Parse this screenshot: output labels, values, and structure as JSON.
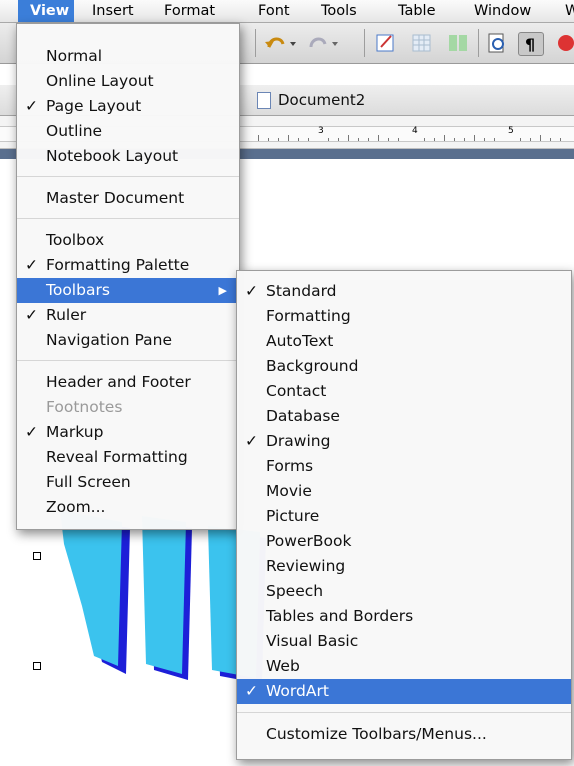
{
  "menubar": {
    "items": [
      "View",
      "Insert",
      "Format",
      "Font",
      "Tools",
      "Table",
      "Window",
      "W"
    ],
    "active": "View"
  },
  "document": {
    "title": "Document2"
  },
  "ruler": {
    "numbers": [
      "3",
      "4",
      "5"
    ]
  },
  "view_menu": {
    "items": [
      {
        "label": "Normal",
        "checked": false
      },
      {
        "label": "Online Layout",
        "checked": false
      },
      {
        "label": "Page Layout",
        "checked": true
      },
      {
        "label": "Outline",
        "checked": false
      },
      {
        "label": "Notebook Layout",
        "checked": false
      },
      {
        "label": "Master Document",
        "checked": false
      },
      {
        "label": "Toolbox",
        "checked": false
      },
      {
        "label": "Formatting Palette",
        "checked": true
      },
      {
        "label": "Toolbars",
        "checked": false,
        "submenu": true,
        "highlighted": true
      },
      {
        "label": "Ruler",
        "checked": true
      },
      {
        "label": "Navigation Pane",
        "checked": false
      },
      {
        "label": "Header and Footer",
        "checked": false
      },
      {
        "label": "Footnotes",
        "checked": false,
        "disabled": true
      },
      {
        "label": "Markup",
        "checked": true
      },
      {
        "label": "Reveal Formatting",
        "checked": false
      },
      {
        "label": "Full Screen",
        "checked": false
      },
      {
        "label": "Zoom...",
        "checked": false
      }
    ]
  },
  "toolbars_submenu": {
    "items": [
      {
        "label": "Standard",
        "checked": true
      },
      {
        "label": "Formatting",
        "checked": false
      },
      {
        "label": "AutoText",
        "checked": false
      },
      {
        "label": "Background",
        "checked": false
      },
      {
        "label": "Contact",
        "checked": false
      },
      {
        "label": "Database",
        "checked": false
      },
      {
        "label": "Drawing",
        "checked": true
      },
      {
        "label": "Forms",
        "checked": false
      },
      {
        "label": "Movie",
        "checked": false
      },
      {
        "label": "Picture",
        "checked": false
      },
      {
        "label": "PowerBook",
        "checked": false
      },
      {
        "label": "Reviewing",
        "checked": false
      },
      {
        "label": "Speech",
        "checked": false
      },
      {
        "label": "Tables and Borders",
        "checked": false
      },
      {
        "label": "Visual Basic",
        "checked": false
      },
      {
        "label": "Web",
        "checked": false
      },
      {
        "label": "WordArt",
        "checked": true,
        "highlighted": true
      },
      {
        "label": "Customize Toolbars/Menus...",
        "checked": false
      }
    ]
  },
  "colors": {
    "highlight": "#3b76d6",
    "wordart_fill": "#3bc3ee",
    "wordart_shadow": "#1d1fd8"
  },
  "icons": [
    "undo-icon",
    "redo-icon",
    "table-icon",
    "pilcrow-icon",
    "zoom-icon",
    "document-icon",
    "checkmark-icon",
    "submenu-arrow-icon"
  ]
}
